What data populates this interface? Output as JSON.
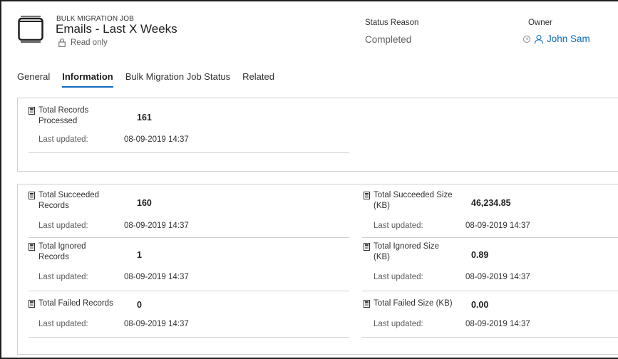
{
  "header": {
    "entity_type": "BULK MIGRATION JOB",
    "title": "Emails - Last X Weeks",
    "readonly_text": "Read only",
    "status_reason_label": "Status Reason",
    "status_reason_value": "Completed",
    "owner_label": "Owner",
    "owner_value": "John Sam"
  },
  "tabs": [
    {
      "label": "General"
    },
    {
      "label": "Information",
      "active": true
    },
    {
      "label": "Bulk Migration Job Status"
    },
    {
      "label": "Related"
    }
  ],
  "section1": {
    "total_records_processed": {
      "label": "Total Records Processed",
      "value": "161",
      "last_updated_label": "Last updated:",
      "last_updated_value": "08-09-2019 14:37"
    }
  },
  "section2": {
    "total_succeeded_records": {
      "label": "Total Succeeded Records",
      "value": "160",
      "last_updated_label": "Last updated:",
      "last_updated_value": "08-09-2019 14:37"
    },
    "total_succeeded_size": {
      "label": "Total Succeeded Size (KB)",
      "value": "46,234.85",
      "last_updated_label": "Last updated:",
      "last_updated_value": "08-09-2019 14:37"
    },
    "total_ignored_records": {
      "label": "Total Ignored Records",
      "value": "1",
      "last_updated_label": "Last updated:",
      "last_updated_value": "08-09-2019 14:37"
    },
    "total_ignored_size": {
      "label": "Total Ignored Size (KB)",
      "value": "0.89",
      "last_updated_label": "Last updated:",
      "last_updated_value": "08-09-2019 14:37"
    },
    "total_failed_records": {
      "label": "Total Failed Records",
      "value": "0",
      "last_updated_label": "Last updated:",
      "last_updated_value": "08-09-2019 14:37"
    },
    "total_failed_size": {
      "label": "Total Failed Size (KB)",
      "value": "0.00",
      "last_updated_label": "Last updated:",
      "last_updated_value": "08-09-2019 14:37"
    }
  },
  "colors": {
    "accent": "#0f6cbd",
    "border": "#d2d0ce"
  }
}
